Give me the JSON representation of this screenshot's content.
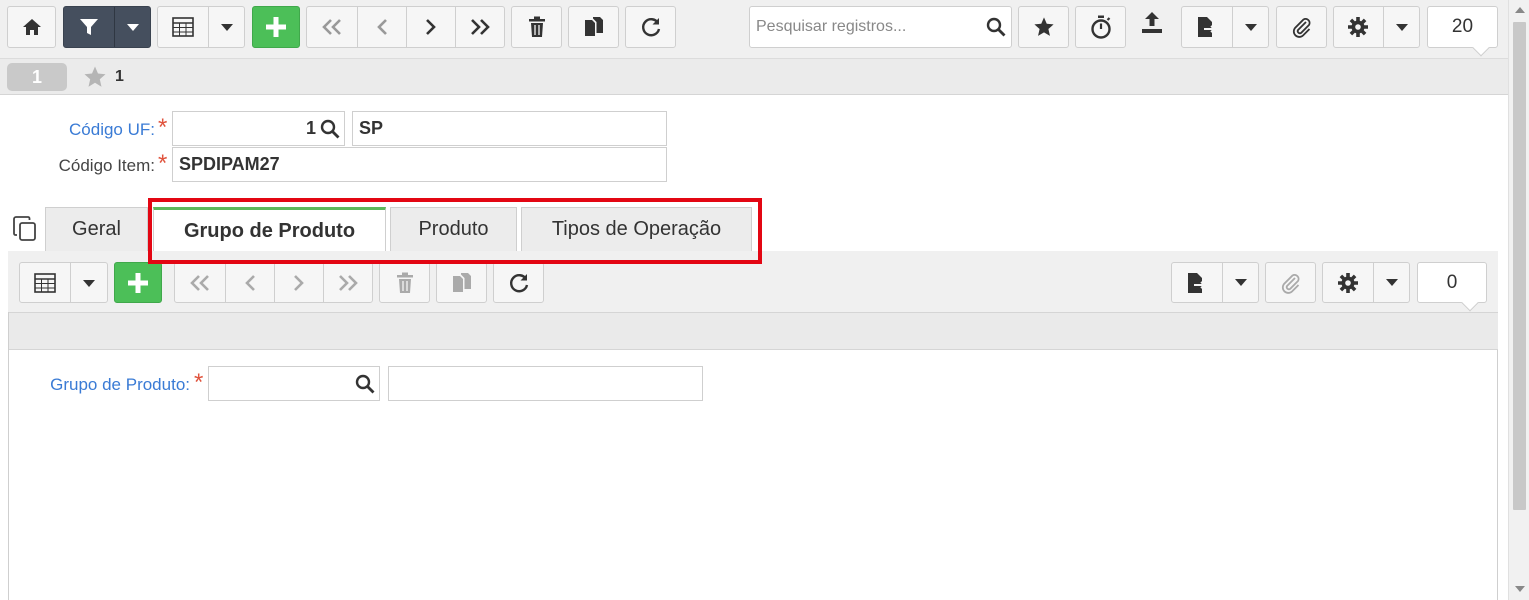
{
  "toolbar": {
    "search_placeholder": "Pesquisar registros...",
    "records_per_page": "20",
    "icons": [
      "home-icon",
      "filter-icon",
      "caret-down-icon",
      "grid-icon",
      "plus-icon",
      "first-icon",
      "prev-icon",
      "next-icon",
      "last-icon",
      "trash-icon",
      "copy-icon",
      "refresh-icon",
      "search-icon",
      "star-icon",
      "stopwatch-icon",
      "upload-icon",
      "export-icon",
      "paperclip-icon",
      "gear-icon"
    ]
  },
  "record_bar": {
    "record_number": "1",
    "favorites_count": "1"
  },
  "form": {
    "uf_label": "Código UF:",
    "uf_code": "1",
    "uf_name": "SP",
    "item_label": "Código Item:",
    "item_code": "SPDIPAM27"
  },
  "tabs": [
    {
      "label": "Geral"
    },
    {
      "label": "Grupo de Produto"
    },
    {
      "label": "Produto"
    },
    {
      "label": "Tipos de Operação"
    }
  ],
  "active_tab": "Grupo de Produto",
  "subform": {
    "records_count": "0",
    "grupo_label": "Grupo de Produto:",
    "grupo_code": "",
    "grupo_desc": ""
  },
  "colors": {
    "accent_green": "#4cbf58",
    "dark_button": "#454f5e",
    "label_blue": "#3a7bd5",
    "required_red": "#e0533d",
    "highlight_red": "#e30613",
    "active_tab_border": "#5cb85c"
  }
}
